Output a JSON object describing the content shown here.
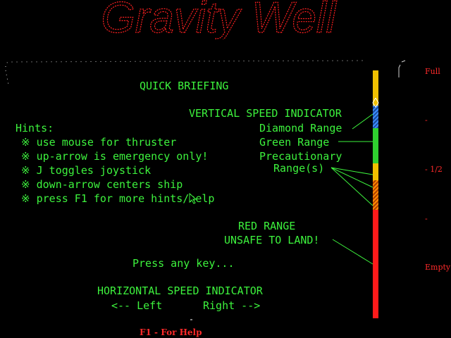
{
  "title": "Gravity Well",
  "briefing": {
    "heading": "QUICK BRIEFING",
    "vsi_label": "VERTICAL SPEED INDICATOR",
    "diamond": "Diamond Range",
    "green": "Green Range",
    "precaution_1": "Precautionary",
    "precaution_2": "Range(s)",
    "red_1": "RED RANGE",
    "red_2": "UNSAFE TO LAND!",
    "press_key": "Press any key...",
    "hsi_label": "HORIZONTAL SPEED INDICATOR",
    "left": "<-- Left",
    "right": "Right -->"
  },
  "hints": {
    "heading": "Hints:",
    "items": [
      "※ use mouse for thruster",
      "※ up-arrow is emergency only!",
      "※ J toggles joystick",
      "※ down-arrow centers ship",
      "※ press F1 for more hints/help"
    ]
  },
  "fuel_gauge": {
    "full": "Full",
    "dash_upper": "-",
    "half": "- 1/2",
    "dash_lower": "-",
    "empty": "Empty"
  },
  "footer": {
    "help": "F1 - For Help"
  },
  "colors": {
    "text": "#3df23d",
    "title": "#ff2020",
    "gauge_yellow": "#f0c000",
    "gauge_blue": "#3a8cff",
    "gauge_green": "#2fd02f",
    "gauge_orange": "#ff8a00",
    "gauge_red": "#ff1a1a"
  }
}
